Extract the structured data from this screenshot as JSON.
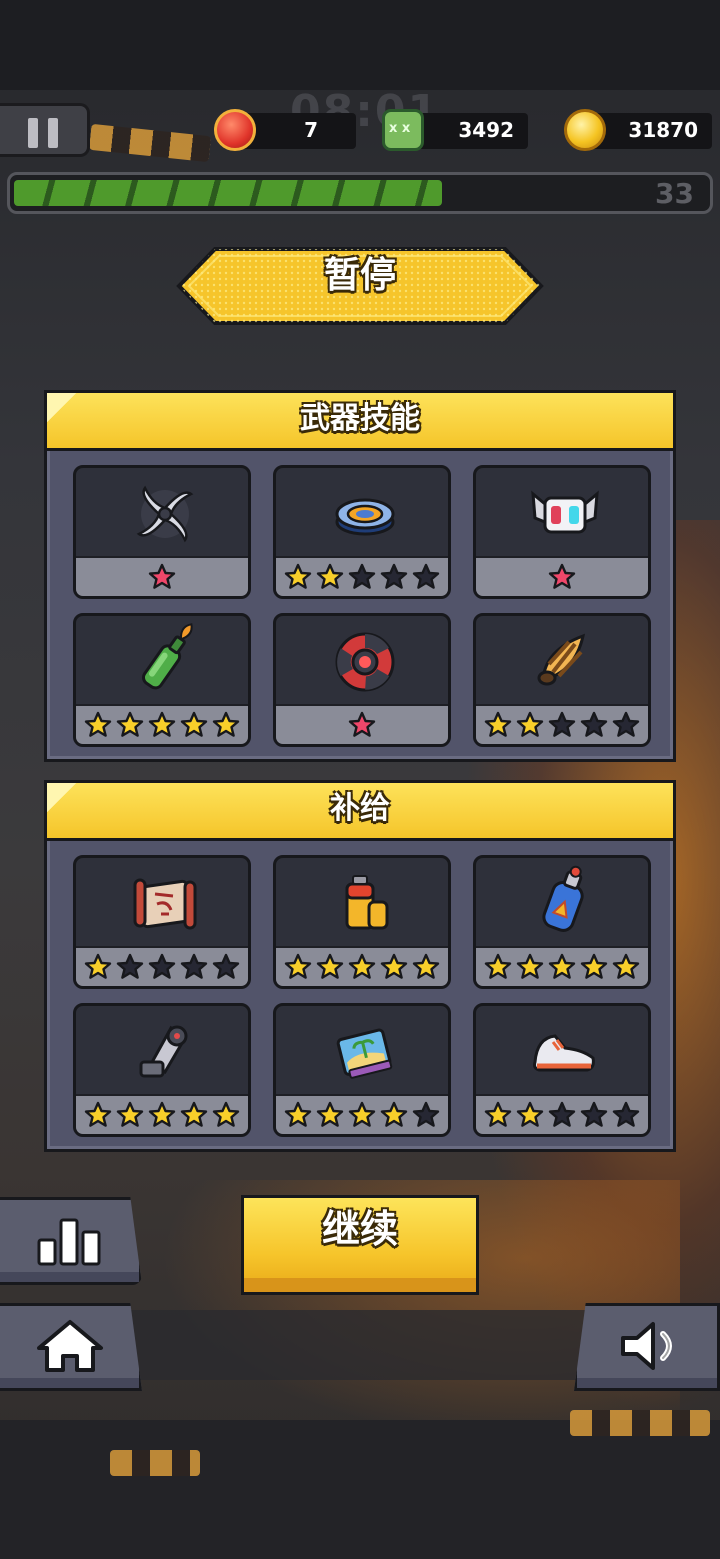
{
  "hud": {
    "hearts": "7",
    "kills": "3492",
    "coins": "31870",
    "level": "33",
    "xp_progress": 0.62,
    "icons": [
      "pause-icon",
      "heart-icon",
      "zombie-icon",
      "coin-icon"
    ]
  },
  "title": "暂停",
  "weapons": {
    "title": "武器技能",
    "items": [
      {
        "icon": "shuriken-icon",
        "stars": 1,
        "max": 1,
        "star_color": "pink"
      },
      {
        "icon": "spinner-disc-icon",
        "stars": 2,
        "max": 5,
        "star_color": "gold"
      },
      {
        "icon": "drone-icon",
        "stars": 1,
        "max": 1,
        "star_color": "pink"
      },
      {
        "icon": "molotov-icon",
        "stars": 5,
        "max": 5,
        "star_color": "gold"
      },
      {
        "icon": "red-target-icon",
        "stars": 1,
        "max": 1,
        "star_color": "pink"
      },
      {
        "icon": "drill-icon",
        "stars": 2,
        "max": 5,
        "star_color": "gold"
      }
    ]
  },
  "supply": {
    "title": "补给",
    "items": [
      {
        "icon": "scroll-icon",
        "stars": 1,
        "max": 5,
        "star_color": "gold"
      },
      {
        "icon": "battery-icon",
        "stars": 5,
        "max": 5,
        "star_color": "gold"
      },
      {
        "icon": "fuel-canister-icon",
        "stars": 5,
        "max": 5,
        "star_color": "gold"
      },
      {
        "icon": "robot-arm-icon",
        "stars": 5,
        "max": 5,
        "star_color": "gold"
      },
      {
        "icon": "book-icon",
        "stars": 4,
        "max": 5,
        "star_color": "gold"
      },
      {
        "icon": "sneaker-icon",
        "stars": 2,
        "max": 5,
        "star_color": "gold"
      }
    ]
  },
  "buttons": {
    "continue": "继续",
    "side_icons": [
      "stats-icon",
      "home-icon",
      "speaker-icon"
    ]
  },
  "colors": {
    "accent_yellow": "#f6c52b",
    "star_gold": "#f8cf2a",
    "star_pink": "#f0476a",
    "star_empty": "#262733",
    "panel": "#52546a",
    "card": "#2e303a"
  }
}
